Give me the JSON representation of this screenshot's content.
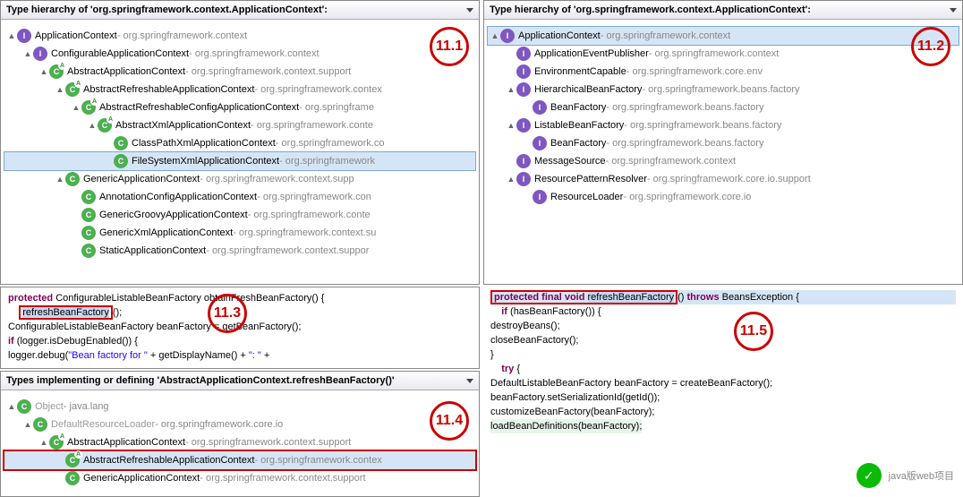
{
  "hierarchy_title": "Type hierarchy of 'org.springframework.context.ApplicationContext':",
  "panel11_1": {
    "badge": "11.1",
    "rows": [
      {
        "indent": 0,
        "twisty": "▲",
        "icon": "I",
        "sup": "",
        "name": "ApplicationContext",
        "pkg": "org.springframework.context",
        "sel": false
      },
      {
        "indent": 1,
        "twisty": "▲",
        "icon": "I",
        "sup": "",
        "name": "ConfigurableApplicationContext",
        "pkg": "org.springframework.context",
        "sel": false
      },
      {
        "indent": 2,
        "twisty": "▲",
        "icon": "C",
        "sup": "A",
        "name": "AbstractApplicationContext",
        "pkg": "org.springframework.context.support",
        "sel": false
      },
      {
        "indent": 3,
        "twisty": "▲",
        "icon": "C",
        "sup": "A",
        "name": "AbstractRefreshableApplicationContext",
        "pkg": "org.springframework.contex",
        "sel": false
      },
      {
        "indent": 4,
        "twisty": "▲",
        "icon": "C",
        "sup": "A",
        "name": "AbstractRefreshableConfigApplicationContext",
        "pkg": "org.springframe",
        "sel": false
      },
      {
        "indent": 5,
        "twisty": "▲",
        "icon": "C",
        "sup": "A",
        "name": "AbstractXmlApplicationContext",
        "pkg": "org.springframework.conte",
        "sel": false
      },
      {
        "indent": 6,
        "twisty": "",
        "icon": "C",
        "sup": "",
        "name": "ClassPathXmlApplicationContext",
        "pkg": "org.springframework.co",
        "sel": false
      },
      {
        "indent": 6,
        "twisty": "",
        "icon": "C",
        "sup": "",
        "name": "FileSystemXmlApplicationContext",
        "pkg": "org.springframework",
        "sel": true
      },
      {
        "indent": 3,
        "twisty": "▲",
        "icon": "C",
        "sup": "",
        "name": "GenericApplicationContext",
        "pkg": "org.springframework.context.supp",
        "sel": false
      },
      {
        "indent": 4,
        "twisty": "",
        "icon": "C",
        "sup": "",
        "name": "AnnotationConfigApplicationContext",
        "pkg": "org.springframework.con",
        "sel": false
      },
      {
        "indent": 4,
        "twisty": "",
        "icon": "C",
        "sup": "",
        "name": "GenericGroovyApplicationContext",
        "pkg": "org.springframework.conte",
        "sel": false
      },
      {
        "indent": 4,
        "twisty": "",
        "icon": "C",
        "sup": "",
        "name": "GenericXmlApplicationContext",
        "pkg": "org.springframework.context.su",
        "sel": false
      },
      {
        "indent": 4,
        "twisty": "",
        "icon": "C",
        "sup": "",
        "name": "StaticApplicationContext",
        "pkg": "org.springframework.context.suppor",
        "sel": false
      }
    ]
  },
  "panel11_2": {
    "badge": "11.2",
    "rows": [
      {
        "indent": 0,
        "twisty": "▲",
        "icon": "I",
        "sup": "",
        "name": "ApplicationContext",
        "pkg": "org.springframework.context",
        "sel": true
      },
      {
        "indent": 1,
        "twisty": "",
        "icon": "I",
        "sup": "",
        "name": "ApplicationEventPublisher",
        "pkg": "org.springframework.context",
        "sel": false
      },
      {
        "indent": 1,
        "twisty": "",
        "icon": "I",
        "sup": "",
        "name": "EnvironmentCapable",
        "pkg": "org.springframework.core.env",
        "sel": false
      },
      {
        "indent": 1,
        "twisty": "▲",
        "icon": "I",
        "sup": "",
        "name": "HierarchicalBeanFactory",
        "pkg": "org.springframework.beans.factory",
        "sel": false
      },
      {
        "indent": 2,
        "twisty": "",
        "icon": "I",
        "sup": "",
        "name": "BeanFactory",
        "pkg": "org.springframework.beans.factory",
        "sel": false
      },
      {
        "indent": 1,
        "twisty": "▲",
        "icon": "I",
        "sup": "",
        "name": "ListableBeanFactory",
        "pkg": "org.springframework.beans.factory",
        "sel": false
      },
      {
        "indent": 2,
        "twisty": "",
        "icon": "I",
        "sup": "",
        "name": "BeanFactory",
        "pkg": "org.springframework.beans.factory",
        "sel": false
      },
      {
        "indent": 1,
        "twisty": "",
        "icon": "I",
        "sup": "",
        "name": "MessageSource",
        "pkg": "org.springframework.context",
        "sel": false
      },
      {
        "indent": 1,
        "twisty": "▲",
        "icon": "I",
        "sup": "",
        "name": "ResourcePatternResolver",
        "pkg": "org.springframework.core.io.support",
        "sel": false
      },
      {
        "indent": 2,
        "twisty": "",
        "icon": "I",
        "sup": "",
        "name": "ResourceLoader",
        "pkg": "org.springframework.core.io",
        "sel": false
      }
    ]
  },
  "panel11_3": {
    "badge": "11.3",
    "code": {
      "line1_pre": "protected ",
      "line1_type": "ConfigurableListableBeanFactory",
      "line1_rest": " obtainFreshBeanFactory() {",
      "line2_call": "refreshBeanFactory",
      "line2_rest": "();",
      "line3": "    ConfigurableListableBeanFactory beanFactory = getBeanFactory();",
      "line4_pre": "    ",
      "line4_kw": "if",
      "line4_rest": " (logger.isDebugEnabled()) {",
      "line5_pre": "        logger.debug(",
      "line5_str": "\"Bean factory for \"",
      "line5_mid": " + getDisplayName() + ",
      "line5_str2": "\": \"",
      "line5_end": " + "
    }
  },
  "panel11_4": {
    "badge": "11.4",
    "title": "Types implementing or defining 'AbstractApplicationContext.refreshBeanFactory()'",
    "rows": [
      {
        "indent": 0,
        "twisty": "▲",
        "icon": "O",
        "sup": "",
        "name": "Object",
        "pkg": "java.lang",
        "sel": false,
        "dim": true
      },
      {
        "indent": 1,
        "twisty": "▲",
        "icon": "C",
        "sup": "",
        "name": "DefaultResourceLoader",
        "pkg": "org.springframework.core.io",
        "sel": false,
        "dim": true
      },
      {
        "indent": 2,
        "twisty": "▲",
        "icon": "C",
        "sup": "A",
        "name": "AbstractApplicationContext",
        "pkg": "org.springframework.context.support",
        "sel": false
      },
      {
        "indent": 3,
        "twisty": "",
        "icon": "C",
        "sup": "A",
        "name": "AbstractRefreshableApplicationContext",
        "pkg": "org.springframework.contex",
        "sel": true,
        "box": true
      },
      {
        "indent": 3,
        "twisty": "",
        "icon": "C",
        "sup": "",
        "name": "GenericApplicationContext",
        "pkg": "org.springframework.context.support",
        "sel": false
      }
    ]
  },
  "panel11_5": {
    "badge": "11.5",
    "code": {
      "l1_pre": "protected final void ",
      "l1_hl": "refreshBeanFactory",
      "l1_post": "() ",
      "l1_kw": "throws",
      "l1_exc": " BeansException {",
      "l2_kw": "if",
      "l2_rest": " (hasBeanFactory()) {",
      "l3": "        destroyBeans();",
      "l4": "        closeBeanFactory();",
      "l5": "    }",
      "l6_kw": "try",
      "l6_rest": " {",
      "l7": "        DefaultListableBeanFactory beanFactory = createBeanFactory();",
      "l8": "        beanFactory.setSerializationId(getId());",
      "l9": "        customizeBeanFactory(beanFactory);",
      "l10": "        loadBeanDefinitions(beanFactory);"
    }
  },
  "watermark": "java版web项目"
}
